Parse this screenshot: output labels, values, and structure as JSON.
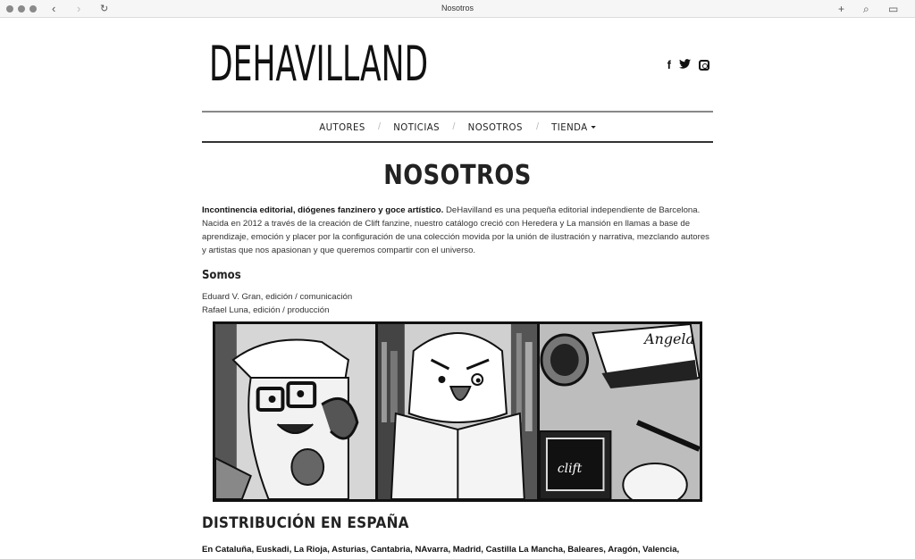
{
  "browser": {
    "title": "Nosotros",
    "back_icon": "‹",
    "forward_icon": "›",
    "reload_icon": "↻",
    "new_tab_icon": "+",
    "search_icon": "⌕",
    "sidebar_icon": "▭"
  },
  "site": {
    "logo": "DEHAVILLAND",
    "social": [
      "facebook-icon",
      "twitter-icon",
      "instagram-icon"
    ],
    "facebook": "f",
    "twitter": "t"
  },
  "nav": {
    "items": [
      {
        "label": "AUTORES"
      },
      {
        "label": "NOTICIAS"
      },
      {
        "label": "NOSOTROS"
      },
      {
        "label": "TIENDA"
      }
    ],
    "separator": "/"
  },
  "main": {
    "title": "NOSOTROS",
    "intro_bold": "Incontinencia editorial, diógenes fanzinero y goce artístico.",
    "intro_text": " DeHavilland es una pequeña editorial independiente de Barcelona. Nacida en 2012 a través de la creación de Clift fanzine, nuestro catálogo creció con Heredera y La mansión en llamas a base de aprendizaje, emoción y placer por la configuración de una colección movida por la unión de ilustración y narrativa, mezclando autores y artistas que nos apasionan y que queremos compartir con el universo.",
    "somos_heading": "Somos",
    "team": [
      "Eduard V. Gran, edición / comunicación",
      "Rafael Luna, edición / producción"
    ],
    "comic_texts": [
      "Angela",
      "clift"
    ],
    "dist_heading": "DISTRIBUCIÓN EN ESPAÑA",
    "dist_text": "En Cataluña, Euskadi, La Rioja, Asturias, Cantabria, NAvarra, Madrid, Castilla La Mancha, Baleares, Aragón, Valencia, Castellón,"
  }
}
